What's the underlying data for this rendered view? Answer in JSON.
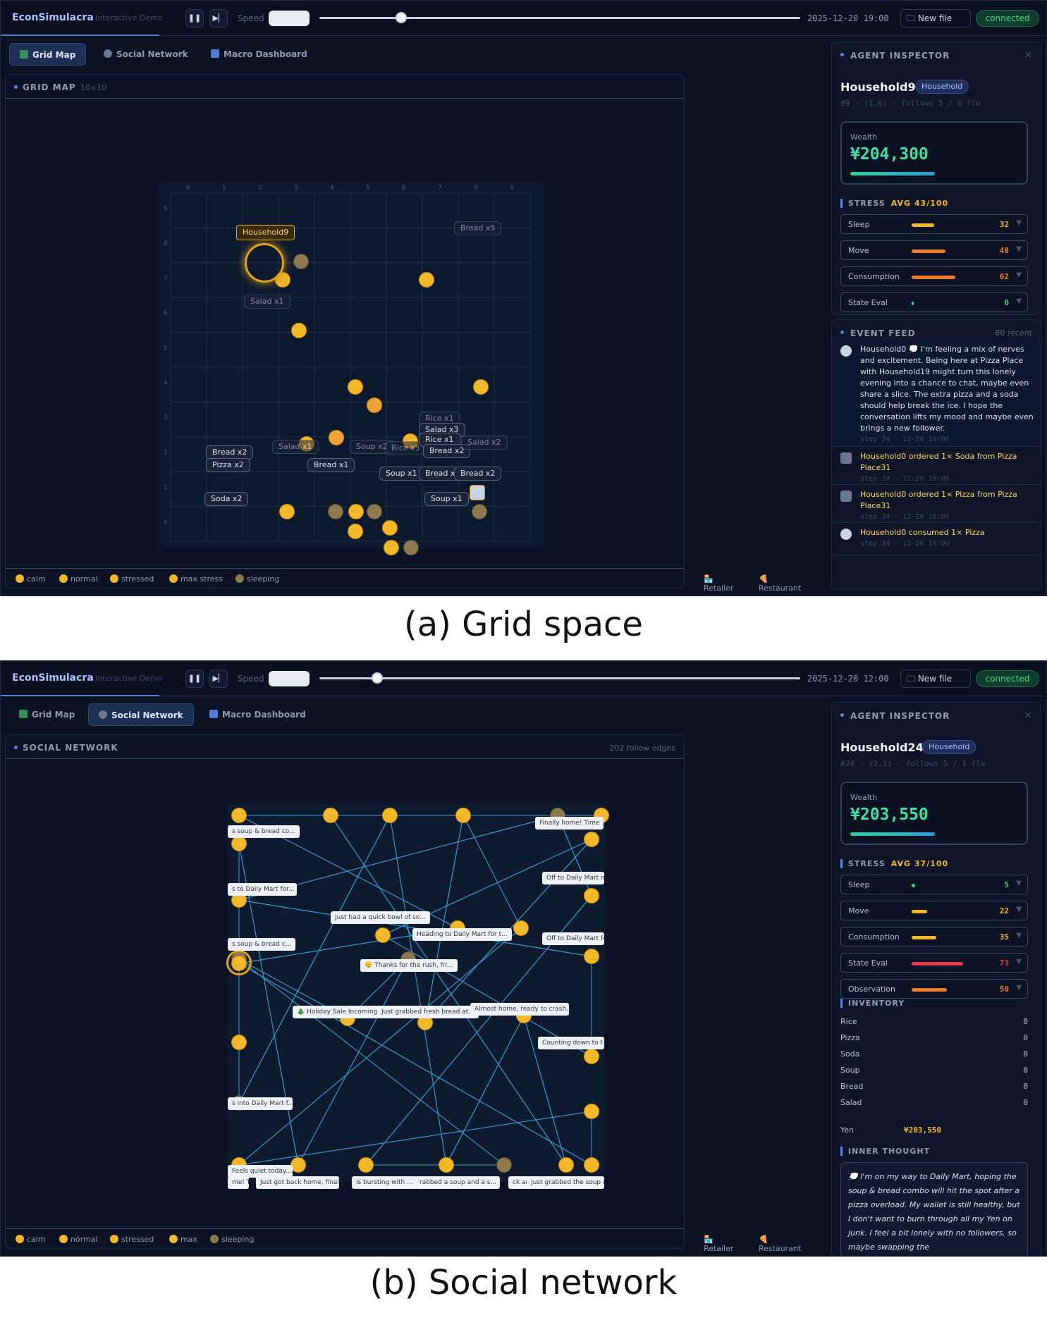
{
  "colors": {
    "accent": "#5f86d8",
    "wealth": "#3ee0a6",
    "connected": "#45d48a",
    "avg": "#f2b72b"
  },
  "panels": [
    {
      "app_name": "EconSimulacra",
      "app_sub": "Interactive Demo",
      "speed_label": "Speed",
      "speed_fraction": 0.17,
      "timestamp": "2025-12-20 19:00",
      "new_file": "New file",
      "status": "connected",
      "tabs": [
        "Grid Map",
        "Social Network",
        "Macro Dashboard"
      ],
      "active_tab": 0,
      "card_title": "GRID MAP",
      "card_sub": "10×10",
      "card_right": "",
      "legend": [
        "calm",
        "normal",
        "stressed",
        "max stress",
        "sleeping"
      ],
      "legend_right": [
        "Retailer",
        "Restaurant"
      ],
      "inspector": {
        "title": "AGENT INSPECTOR",
        "name": "Household9",
        "badge": "Household",
        "meta": "#9 · (1,6) · follows 5 / 0 flw",
        "wealth_label": "Wealth",
        "wealth_value": "¥204,300",
        "stress_title": "STRESS",
        "stress_avg": "AVG 43/100",
        "stress": [
          {
            "label": "Sleep",
            "value": "32",
            "level": 32,
            "color": "#f2b72b"
          },
          {
            "label": "Move",
            "value": "48",
            "level": 48,
            "color": "#f07a2a"
          },
          {
            "label": "Consumption",
            "value": "62",
            "level": 62,
            "color": "#f07a2a"
          },
          {
            "label": "State Eval",
            "value": "0",
            "level": 0,
            "color": "#45d48a"
          }
        ]
      },
      "feed": {
        "title": "EVENT FEED",
        "count": "80 recent",
        "items": [
          {
            "text": "Household0 💭 I'm feeling a mix of nerves and excitement. Being here at Pizza Place with Household19 might turn this lonely evening into a chance to chat, maybe even share a slice. The extra pizza and a soda should help break the ice. I hope the conversation lifts my mood and maybe even brings a new follower.",
            "step": "step 34 · 12-20 19:00"
          },
          {
            "text": "Household0 ordered 1× Soda from Pizza Place31",
            "step": "step 34 · 12-20 19:00"
          },
          {
            "text": "Household0 ordered 1× Pizza from Pizza Place31",
            "step": "step 34 · 12-20 19:00"
          },
          {
            "text": "Household0 consumed 1× Pizza",
            "step": "step 34 · 12-20 19:00"
          }
        ]
      },
      "grid": {
        "col_labels": [
          "0",
          "1",
          "2",
          "3",
          "4",
          "5",
          "6",
          "7",
          "8",
          "9"
        ],
        "row_labels": [
          "9",
          "8",
          "7",
          "6",
          "5",
          "4",
          "3",
          "2",
          "1",
          "0"
        ],
        "selected_label": "Household9",
        "chips": [
          "Bread x5",
          "Salad x1",
          "Bread x2",
          "Pizza x2",
          "Salad x1",
          "Bread x1",
          "Soup x2",
          "Rice x5",
          "Rice x1",
          "Salad x3",
          "Rice x1",
          "Bread x2",
          "Soup x1",
          "Bread x",
          "Bread x2",
          "Soup x1",
          "Soda x2",
          "Salad x2"
        ]
      }
    },
    {
      "app_name": "EconSimulacra",
      "app_sub": "Interactive Demo",
      "speed_label": "Speed",
      "speed_fraction": 0.12,
      "timestamp": "2025-12-20 12:00",
      "new_file": "New file",
      "status": "connected",
      "tabs": [
        "Grid Map",
        "Social Network",
        "Macro Dashboard"
      ],
      "active_tab": 1,
      "card_title": "SOCIAL NETWORK",
      "card_sub": "",
      "card_right": "202 follow edges",
      "legend": [
        "calm",
        "normal",
        "stressed",
        "max",
        "sleeping"
      ],
      "legend_right": [
        "Retailer",
        "Restaurant"
      ],
      "inspector": {
        "title": "AGENT INSPECTOR",
        "name": "Household24",
        "badge": "Household",
        "meta": "#24 · (3,1) · follows 5 / 1 flw",
        "wealth_label": "Wealth",
        "wealth_value": "¥203,550",
        "stress_title": "STRESS",
        "stress_avg": "AVG 37/100",
        "stress": [
          {
            "label": "Sleep",
            "value": "5",
            "level": 5,
            "color": "#45d48a"
          },
          {
            "label": "Move",
            "value": "22",
            "level": 22,
            "color": "#f2b72b"
          },
          {
            "label": "Consumption",
            "value": "35",
            "level": 35,
            "color": "#f2b72b"
          },
          {
            "label": "State Eval",
            "value": "73",
            "level": 73,
            "color": "#e8374a"
          },
          {
            "label": "Observation",
            "value": "50",
            "level": 50,
            "color": "#f07a2a"
          }
        ],
        "inventory_title": "INVENTORY",
        "inventory": [
          {
            "name": "Rice",
            "qty": "0"
          },
          {
            "name": "Pizza",
            "qty": "0"
          },
          {
            "name": "Soda",
            "qty": "0"
          },
          {
            "name": "Soup",
            "qty": "0"
          },
          {
            "name": "Bread",
            "qty": "0"
          },
          {
            "name": "Salad",
            "qty": "0"
          }
        ],
        "yen_label": "Yen",
        "yen_value": "¥203,550",
        "thought_title": "INNER THOUGHT",
        "thought": "💭 I'm on my way to Daily Mart, hoping the soup & bread combo will hit the spot after a pizza overload. My wallet is still healthy, but I don't want to burn through all my Yen on junk. I feel a bit lonely with no followers, so maybe swapping the"
      },
      "network": {
        "bubbles": [
          "s soup & bread co...",
          "Finally home! Time",
          "s to Daily Mart for...",
          "Off to Daily Mart n",
          "Just had a quick bowl of so...",
          "Heading to Daily Mart for t...",
          "s soup & bread c...",
          "Off to Daily Mart fo",
          "😮‍💨 Thanks for the rush, fri...",
          "🎄 Holiday Sale Incoming 🎄",
          "Just grabbed fresh bread at...",
          "Almost home, ready to crash...",
          "Counting down to t",
          "s into Daily Mart f...",
          "Feels quiet today....",
          "me! Ti",
          "Just got back home, finally...",
          "is bursting with ...",
          "rabbed a soup and a s...",
          "ck and",
          "Just grabbed the soup &"
        ]
      }
    }
  ],
  "captions": [
    "(a) Grid space",
    "(b) Social network"
  ]
}
